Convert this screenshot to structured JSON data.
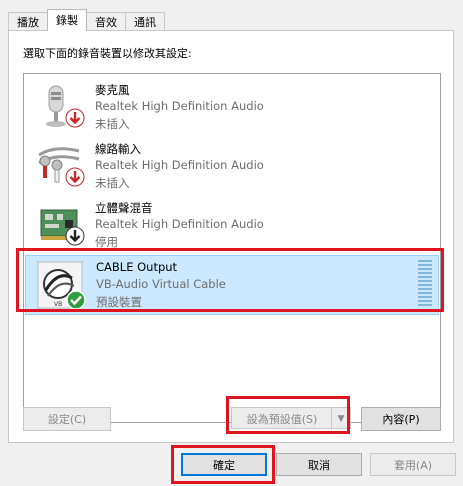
{
  "tabs": [
    {
      "label": "播放"
    },
    {
      "label": "錄製"
    },
    {
      "label": "音效"
    },
    {
      "label": "通訊"
    }
  ],
  "instruction": "選取下面的錄音裝置以修改其設定:",
  "devices": [
    {
      "name": "麥克風",
      "description": "Realtek High Definition Audio",
      "status": "未插入",
      "icon": "microphone-icon",
      "badge": "down-arrow-red"
    },
    {
      "name": "線路輸入",
      "description": "Realtek High Definition Audio",
      "status": "未插入",
      "icon": "line-in-cable-icon",
      "badge": "down-arrow-red"
    },
    {
      "name": "立體聲混音",
      "description": "Realtek High Definition Audio",
      "status": "停用",
      "icon": "sound-card-icon",
      "badge": "down-arrow-black"
    },
    {
      "name": "CABLE Output",
      "description": "VB-Audio Virtual Cable",
      "status": "預設裝置",
      "icon": "cable-device-icon",
      "badge": "green-check",
      "selected": true
    }
  ],
  "buttons": {
    "configure": "設定(C)",
    "set_default": "設為預設值(S)",
    "properties": "內容(P)",
    "ok": "確定",
    "cancel": "取消",
    "apply": "套用(A)"
  },
  "colors": {
    "selection": "#cce8ff",
    "highlight_red": "#e0141e",
    "default_button_border": "#0078d7"
  }
}
